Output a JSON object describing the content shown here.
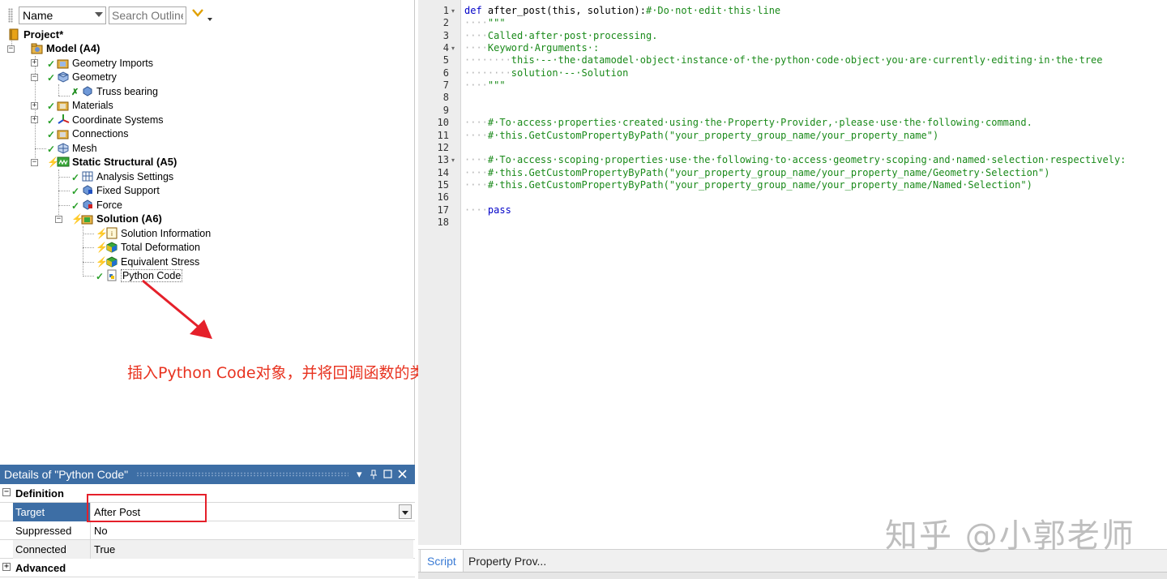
{
  "outline": {
    "column_select": "Name",
    "search_placeholder": "Search Outline",
    "tree": [
      {
        "label": "Project*",
        "bold": true
      },
      {
        "label": "Model (A4)",
        "bold": true
      },
      {
        "label": "Geometry Imports"
      },
      {
        "label": "Geometry"
      },
      {
        "label": "Truss bearing"
      },
      {
        "label": "Materials"
      },
      {
        "label": "Coordinate Systems"
      },
      {
        "label": "Connections"
      },
      {
        "label": "Mesh"
      },
      {
        "label": "Static Structural (A5)",
        "bold": true
      },
      {
        "label": "Analysis Settings"
      },
      {
        "label": "Fixed Support"
      },
      {
        "label": "Force"
      },
      {
        "label": "Solution (A6)",
        "bold": true
      },
      {
        "label": "Solution Information"
      },
      {
        "label": "Total Deformation"
      },
      {
        "label": "Equivalent Stress"
      },
      {
        "label": "Python Code",
        "selected": true
      }
    ]
  },
  "annotation": {
    "text": "插入Python Code对象，并将回调函数的类型改为“After Post”",
    "color": "#e8321f"
  },
  "details": {
    "title": "Details of \"Python Code\"",
    "title_buttons": [
      "▾",
      "ᵖ",
      "□",
      "✕"
    ],
    "groups": {
      "definition": "Definition",
      "advanced": "Advanced"
    },
    "rows": [
      {
        "key": "Target Callback",
        "value": "After Post"
      },
      {
        "key": "Suppressed",
        "value": "No"
      },
      {
        "key": "Connected",
        "value": "True"
      }
    ],
    "expand_minus": "−",
    "expand_plus": "+"
  },
  "editor": {
    "lines": [
      {
        "n": "1",
        "fold": "▾"
      },
      {
        "n": "2"
      },
      {
        "n": "3"
      },
      {
        "n": "4",
        "fold": "▾"
      },
      {
        "n": "5"
      },
      {
        "n": "6"
      },
      {
        "n": "7"
      },
      {
        "n": "8"
      },
      {
        "n": "9"
      },
      {
        "n": "10"
      },
      {
        "n": "11"
      },
      {
        "n": "12"
      },
      {
        "n": "13",
        "fold": "▾"
      },
      {
        "n": "14"
      },
      {
        "n": "15"
      },
      {
        "n": "16"
      },
      {
        "n": "17"
      },
      {
        "n": "18"
      }
    ],
    "code": {
      "l1_kw": "def",
      "l1_rest": " after_post(this, solution):",
      "l1_cm": "# Do not edit this line",
      "l2": "\"\"\"",
      "l3": "Called after post processing.",
      "l4": "Keyword Arguments :",
      "l5": "this -- the datamodel object instance of the python code object you are currently editing in the tree",
      "l6": "solution -- Solution",
      "l7": "\"\"\"",
      "l10": "# To access properties created using the Property Provider, please use the following command.",
      "l11": "# this.GetCustomPropertyByPath(\"your_property_group_name/your_property_name\")",
      "l13": "# To access scoping properties use the following to access geometry scoping and named selection respectively:",
      "l14": "# this.GetCustomPropertyByPath(\"your_property_group_name/your_property_name/Geometry Selection\")",
      "l15": "# this.GetCustomPropertyByPath(\"your_property_group_name/your_property_name/Named Selection\")",
      "l17": "pass"
    }
  },
  "bottom_tabs": {
    "script": "Script",
    "property": "Property Prov..."
  },
  "watermark": "知乎 @小郭老师",
  "colors": {
    "accent": "#3d6ea5",
    "keyword": "#0000c8",
    "comment": "#1a8a1a",
    "highlight_box": "#e5202a"
  }
}
